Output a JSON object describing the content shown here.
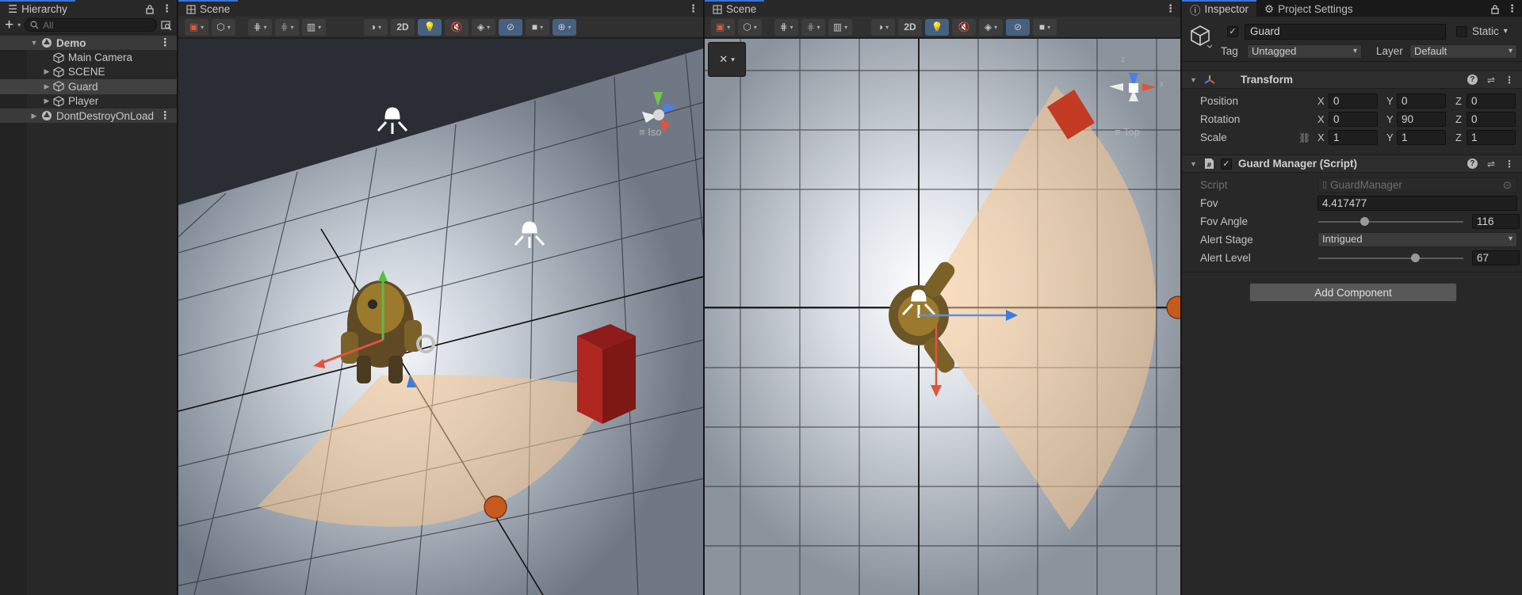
{
  "hierarchy": {
    "tab_label": "Hierarchy",
    "search_placeholder": "All",
    "items": [
      {
        "label": "Demo",
        "type": "scene"
      },
      {
        "label": "Main Camera",
        "type": "object"
      },
      {
        "label": "SCENE",
        "type": "object"
      },
      {
        "label": "Guard",
        "type": "object",
        "selected": true
      },
      {
        "label": "Player",
        "type": "object"
      },
      {
        "label": "DontDestroyOnLoad",
        "type": "scene"
      }
    ]
  },
  "scene_left": {
    "tab_label": "Scene",
    "toggle_2d": "2D",
    "gizmo_label": "Iso"
  },
  "scene_right": {
    "tab_label": "Scene",
    "toggle_2d": "2D",
    "gizmo_label": "Top",
    "gizmo_axes": {
      "x": "x",
      "z": "z"
    }
  },
  "inspector": {
    "tab_label": "Inspector",
    "tab2_label": "Project Settings",
    "object_name": "Guard",
    "static_label": "Static",
    "tag_label": "Tag",
    "tag_value": "Untagged",
    "layer_label": "Layer",
    "layer_value": "Default",
    "transform": {
      "title": "Transform",
      "position": {
        "label": "Position",
        "x": "0",
        "y": "0",
        "z": "0"
      },
      "rotation": {
        "label": "Rotation",
        "x": "0",
        "y": "90",
        "z": "0"
      },
      "scale": {
        "label": "Scale",
        "x": "1",
        "y": "1",
        "z": "1"
      }
    },
    "script_component": {
      "title": "Guard Manager (Script)",
      "script_label": "Script",
      "script_value": "GuardManager",
      "fov_label": "Fov",
      "fov_value": "4.417477",
      "fov_angle_label": "Fov Angle",
      "fov_angle_value": "116",
      "fov_angle_fraction": 0.32,
      "alert_stage_label": "Alert Stage",
      "alert_stage_value": "Intrigued",
      "alert_level_label": "Alert Level",
      "alert_level_value": "67",
      "alert_level_fraction": 0.67
    },
    "add_component_label": "Add Component"
  }
}
